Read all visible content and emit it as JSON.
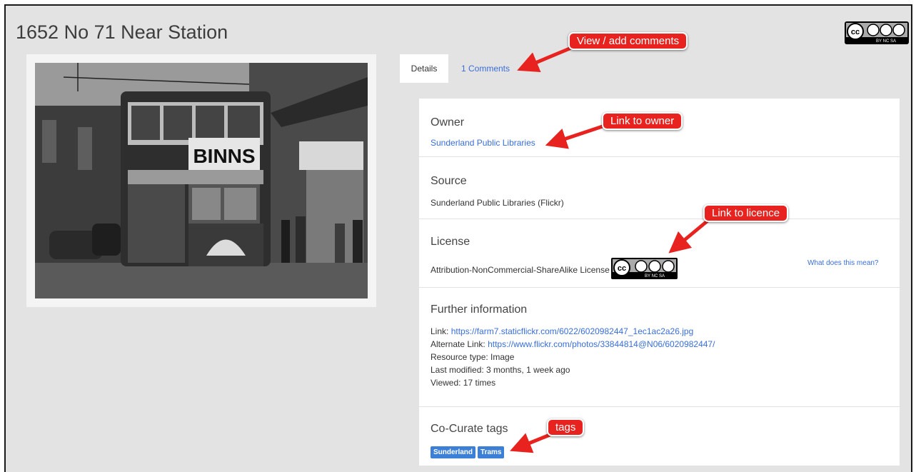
{
  "page": {
    "title": "1652 No 71 Near Station"
  },
  "license_badge": {
    "cc": "cc",
    "sub": "BY NC SA"
  },
  "tabs": [
    {
      "label": "Details",
      "active": true
    },
    {
      "label": "1 Comments",
      "active": false
    }
  ],
  "owner": {
    "heading": "Owner",
    "link": "Sunderland Public Libraries"
  },
  "source": {
    "heading": "Source",
    "text": "Sunderland Public Libraries (Flickr)"
  },
  "license": {
    "heading": "License",
    "text": "Attribution-NonCommercial-ShareAlike License",
    "help_link": "What does this mean?"
  },
  "further": {
    "heading": "Further information",
    "link_label": "Link:",
    "link_url": "https://farm7.staticflickr.com/6022/6020982447_1ec1ac2a26.jpg",
    "alt_label": "Alternate Link:",
    "alt_url": "https://www.flickr.com/photos/33844814@N06/6020982447/",
    "resource_type": "Resource type: Image",
    "last_modified": "Last modified: 3 months, 1 week ago",
    "viewed": "Viewed: 17 times"
  },
  "tags": {
    "heading": "Co-Curate tags",
    "items": [
      "Sunderland",
      "Trams"
    ]
  },
  "callouts": {
    "comments": "View / add comments",
    "owner": "Link to owner",
    "licence": "Link to licence",
    "tags": "tags"
  },
  "photo_sign": "BINNS",
  "colors": {
    "link": "#3a6ed8",
    "tag": "#3b7fd6",
    "callout": "#e8231f",
    "background": "#e3e3e3"
  }
}
